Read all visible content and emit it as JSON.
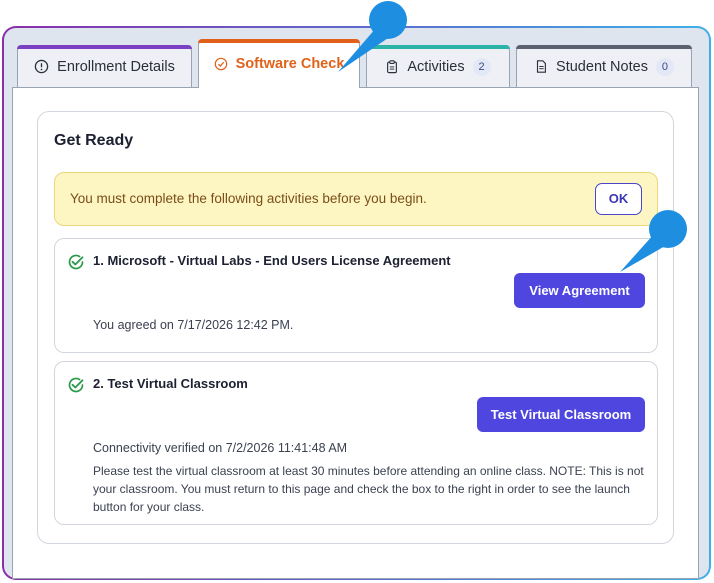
{
  "tabs": [
    {
      "label": "Enrollment Details",
      "icon": "alert-circle-icon"
    },
    {
      "label": "Software Check",
      "icon": "check-circle-icon"
    },
    {
      "label": "Activities",
      "icon": "clipboard-icon",
      "badge": "2"
    },
    {
      "label": "Student Notes",
      "icon": "document-icon",
      "badge": "0"
    }
  ],
  "card": {
    "title": "Get Ready",
    "alert": {
      "text": "You must complete the following activities before you begin.",
      "ok_label": "OK"
    },
    "items": [
      {
        "title": "1. Microsoft - Virtual Labs - End Users License Agreement",
        "button": "View Agreement",
        "meta": "You agreed on 7/17/2026 12:42 PM."
      },
      {
        "title": "2. Test Virtual Classroom",
        "button": "Test Virtual Classroom",
        "meta": "Connectivity verified on 7/2/2026 11:41:48 AM",
        "description": "Please test the virtual classroom at least 30 minutes before attending an online class. NOTE: This is not your classroom. You must return to this page and check the box to the right in order to see the launch button for your class."
      }
    ]
  },
  "colors": {
    "accent_orange": "#e0621a",
    "button_purple": "#4f46e0",
    "success_green": "#2a9a4a",
    "pointer_blue": "#1e8fe0"
  }
}
